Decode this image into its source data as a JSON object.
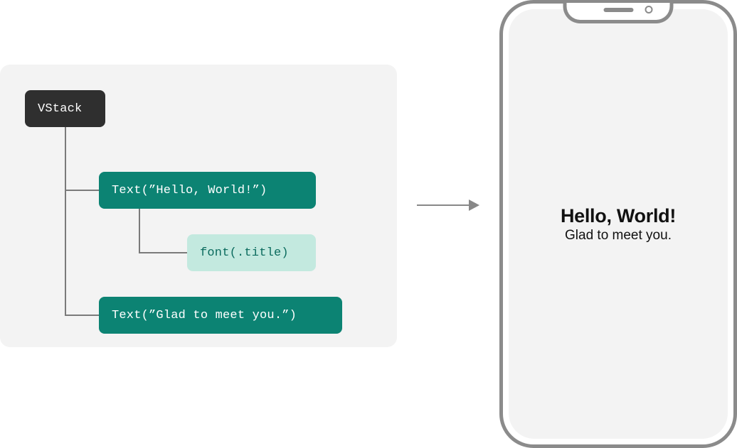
{
  "tree": {
    "root": {
      "label": "VStack"
    },
    "text1": {
      "label": "Text(”Hello, World!”)"
    },
    "font": {
      "label": "font(.title)"
    },
    "text2": {
      "label": "Text(”Glad to meet you.”)"
    }
  },
  "preview": {
    "title": "Hello, World!",
    "body": "Glad to meet you."
  },
  "colors": {
    "panel_bg": "#f3f3f3",
    "root_bg": "#2f2f2f",
    "text_node_bg": "#0c8373",
    "modifier_bg": "#c3e9df",
    "phone_border": "#8b8b8b"
  }
}
